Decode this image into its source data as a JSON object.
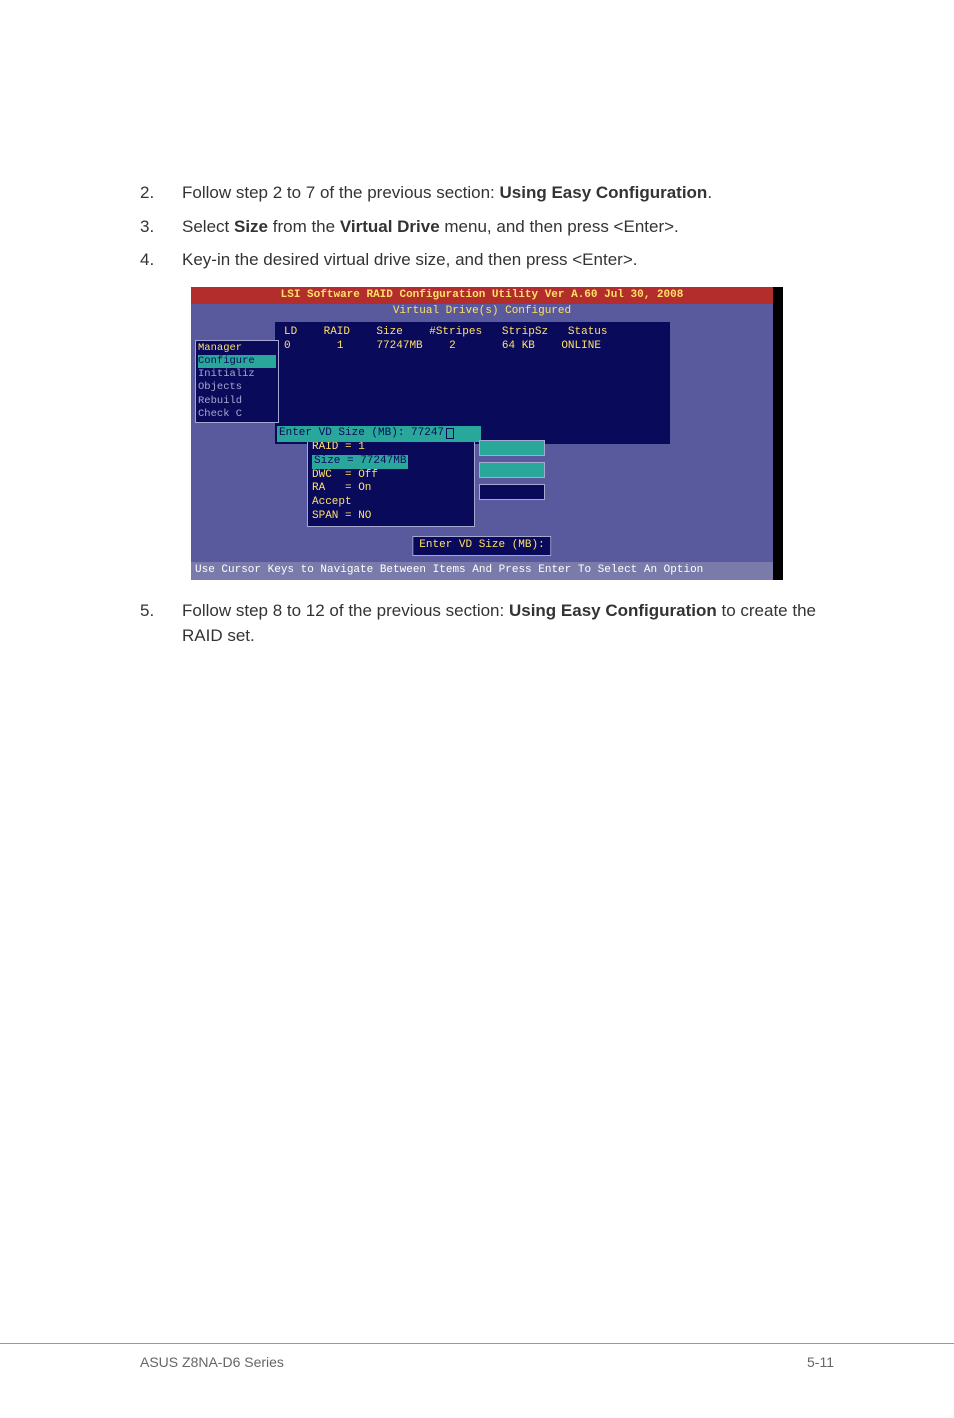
{
  "steps": {
    "s2": {
      "num": "2.",
      "pre": "Follow step 2 to 7 of the previous section: ",
      "bold": "Using Easy Configuration",
      "post": "."
    },
    "s3": {
      "num": "3.",
      "pre": "Select ",
      "b1": "Size",
      "mid": " from the ",
      "b2": "Virtual Drive",
      "post": " menu, and then press <Enter>."
    },
    "s4": {
      "num": "4.",
      "text": "Key-in the desired virtual drive size, and then press <Enter>."
    },
    "s5": {
      "num": "5.",
      "pre": "Follow step 8 to 12 of the previous section: ",
      "bold": "Using Easy Configuration",
      "post": " to create the RAID set."
    }
  },
  "bios": {
    "title": "LSI Software RAID Configuration Utility Ver A.60 Jul 30, 2008",
    "subtitle": "Virtual Drive(s) Configured",
    "headers": {
      "ld": "LD",
      "raid": "RAID",
      "size": "Size",
      "stripes": "#Stripes",
      "stripsz": "StripSz",
      "status": "Status"
    },
    "row": {
      "ld": "0",
      "raid": "1",
      "size": "77247MB",
      "stripes": "2",
      "stripsz": "64 KB",
      "status": "ONLINE"
    },
    "menu": {
      "mgr": "Manager",
      "configure": "Configure",
      "initialize": "Initializ",
      "objects": "Objects",
      "rebuild": "Rebuild",
      "check": "Check C"
    },
    "input_label": "Enter VD Size (MB): 77247",
    "params": {
      "raid": "RAID = 1",
      "size": "Size = 77247MB",
      "dwc": "DWC  = Off",
      "ra": "RA   = On",
      "accept": "Accept",
      "span": "SPAN = NO"
    },
    "enter_label": "Enter VD Size (MB):",
    "help": "Use Cursor Keys to Navigate Between Items And Press Enter To Select An Option"
  },
  "footer": {
    "left": "ASUS Z8NA-D6 Series",
    "right": "5-11"
  }
}
